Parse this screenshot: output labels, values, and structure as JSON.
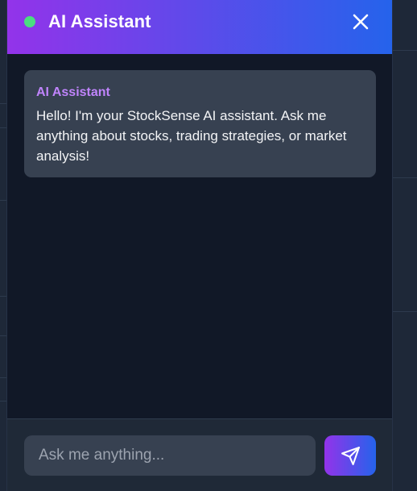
{
  "header": {
    "title": "AI Assistant",
    "status_color": "#4ade80",
    "close_icon": "close-icon"
  },
  "messages": [
    {
      "sender": "AI Assistant",
      "text": "Hello! I'm your StockSense AI assistant. Ask me anything about stocks, trading strategies, or market analysis!"
    }
  ],
  "input": {
    "placeholder": "Ask me anything...",
    "value": ""
  },
  "send_button": {
    "icon": "send-icon"
  },
  "colors": {
    "gradient_start": "#9333ea",
    "gradient_end": "#2563eb",
    "panel_bg": "#111827",
    "bubble_bg": "#374151",
    "sender_color": "#c084fc"
  }
}
